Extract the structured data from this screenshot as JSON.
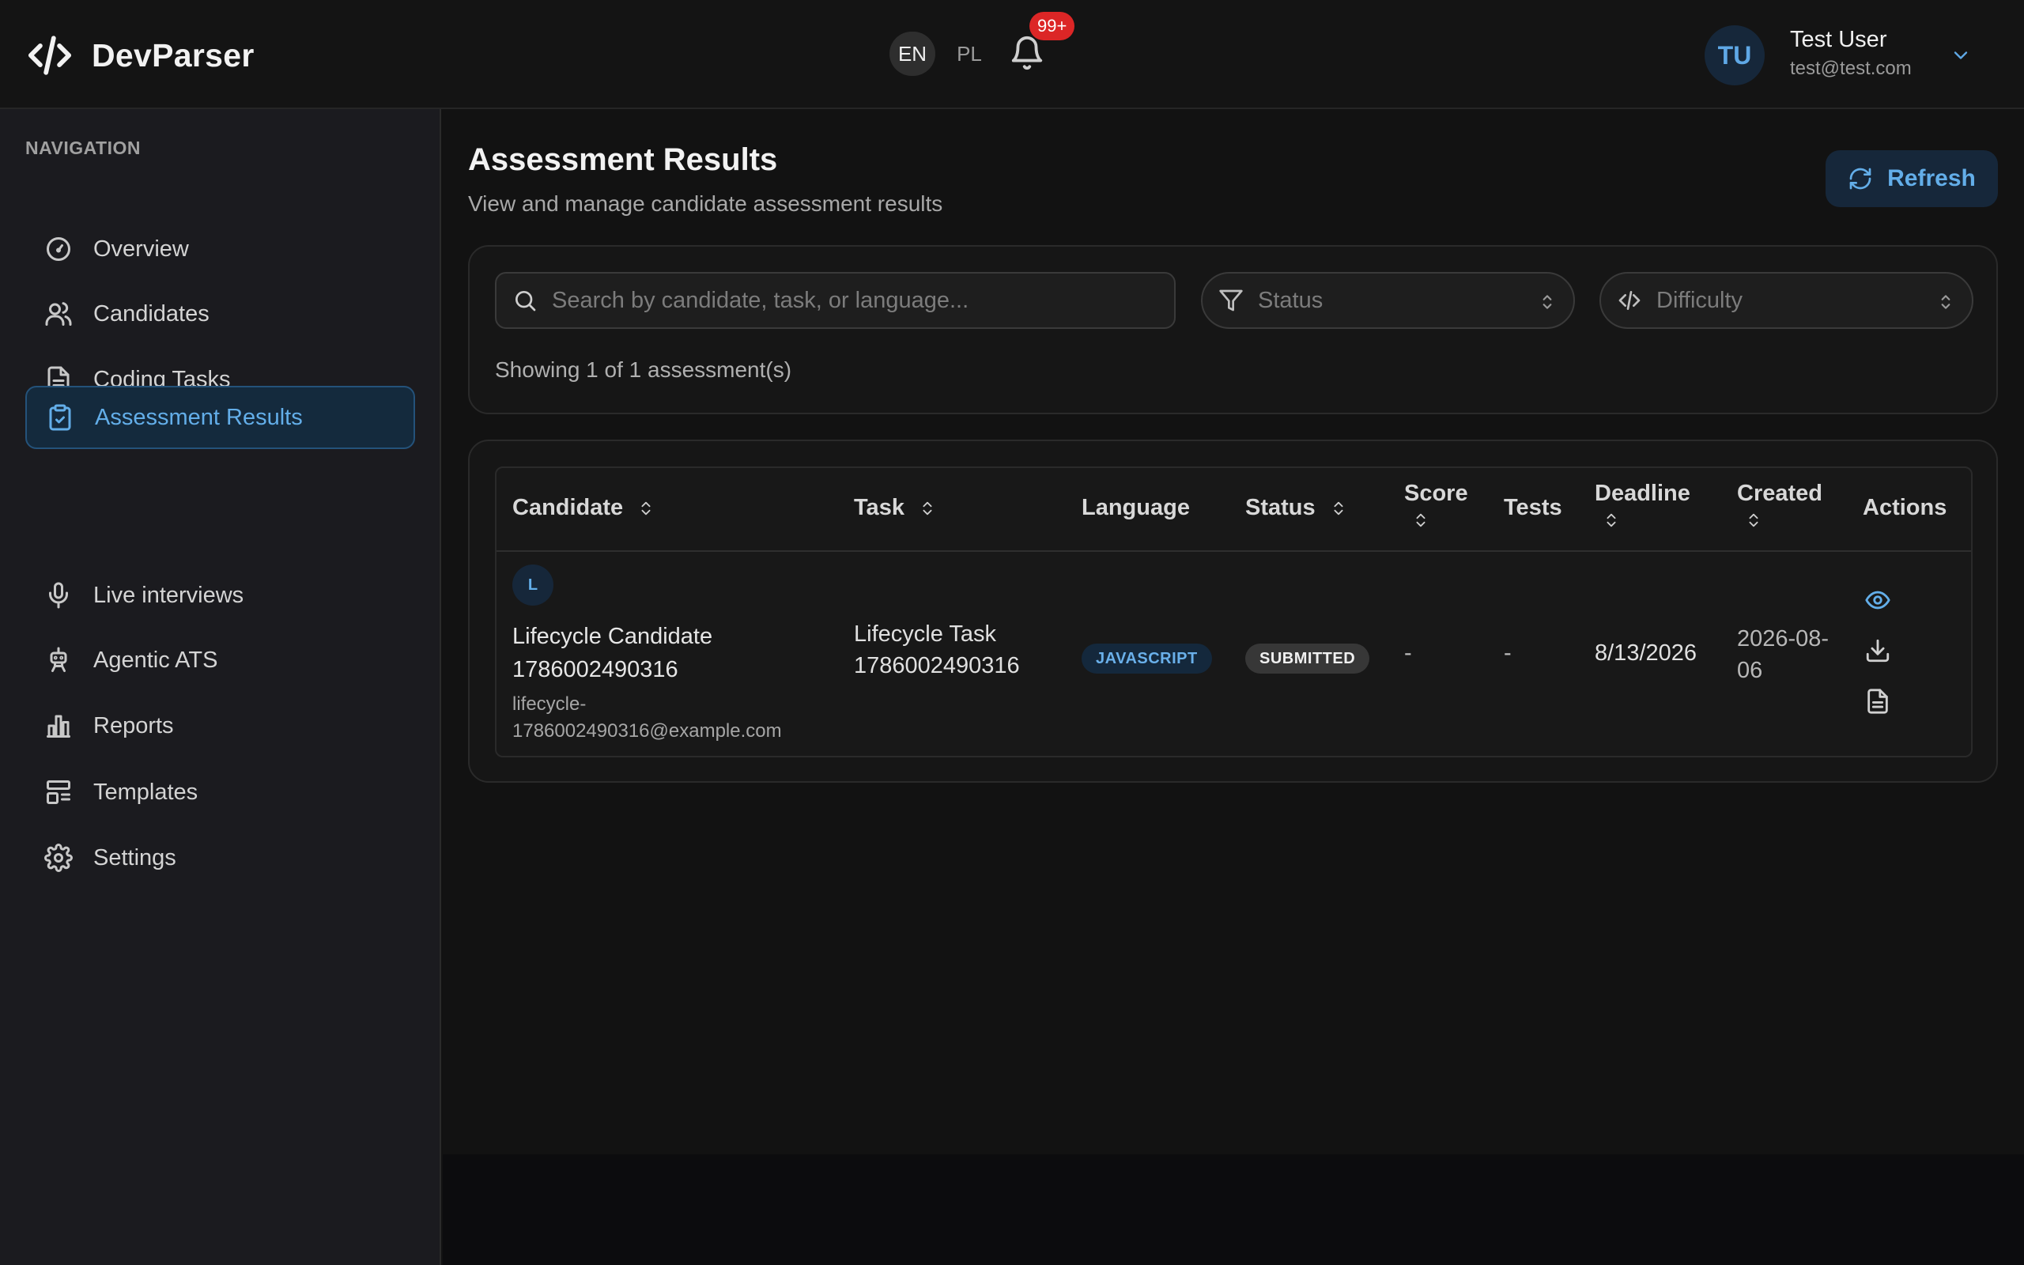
{
  "app": {
    "name": "DevParser"
  },
  "header": {
    "languages": [
      "EN",
      "PL"
    ],
    "active_language": "EN",
    "notification_count": "99+",
    "user": {
      "initials": "TU",
      "name": "Test User",
      "email": "test@test.com"
    }
  },
  "sidebar": {
    "heading": "NAVIGATION",
    "items": [
      {
        "label": "Overview",
        "icon": "gauge-icon"
      },
      {
        "label": "Candidates",
        "icon": "users-icon"
      },
      {
        "label": "Coding Tasks",
        "icon": "file-text-icon"
      },
      {
        "label": "Assessment Results",
        "icon": "clipboard-check-icon",
        "active": true
      },
      {
        "label": "Live interviews",
        "icon": "microphone-icon"
      },
      {
        "label": "Agentic ATS",
        "icon": "robot-icon"
      },
      {
        "label": "Reports",
        "icon": "bar-chart-icon"
      },
      {
        "label": "Templates",
        "icon": "layout-template-icon"
      },
      {
        "label": "Settings",
        "icon": "gear-icon"
      }
    ]
  },
  "page": {
    "title": "Assessment Results",
    "subtitle": "View and manage candidate assessment results",
    "refresh_label": "Refresh"
  },
  "filters": {
    "search_placeholder": "Search by candidate, task, or language...",
    "status_placeholder": "Status",
    "difficulty_placeholder": "Difficulty",
    "showing_text": "Showing 1 of 1 assessment(s)"
  },
  "table": {
    "columns": [
      "Candidate",
      "Task",
      "Language",
      "Status",
      "Score",
      "Tests",
      "Deadline",
      "Created",
      "Actions"
    ],
    "rows": [
      {
        "avatar_initial": "L",
        "candidate_name": "Lifecycle Candidate 1786002490316",
        "candidate_email": "lifecycle-1786002490316@example.com",
        "task": "Lifecycle Task 1786002490316",
        "language": "JAVASCRIPT",
        "status": "SUBMITTED",
        "score": "-",
        "tests": "-",
        "deadline": "8/13/2026",
        "created": "2026-08-06"
      }
    ]
  },
  "colors": {
    "accent": "#63aee9",
    "badge_red": "#dc2626",
    "background": "#121212",
    "sidebar_bg": "#1b1b1f"
  }
}
